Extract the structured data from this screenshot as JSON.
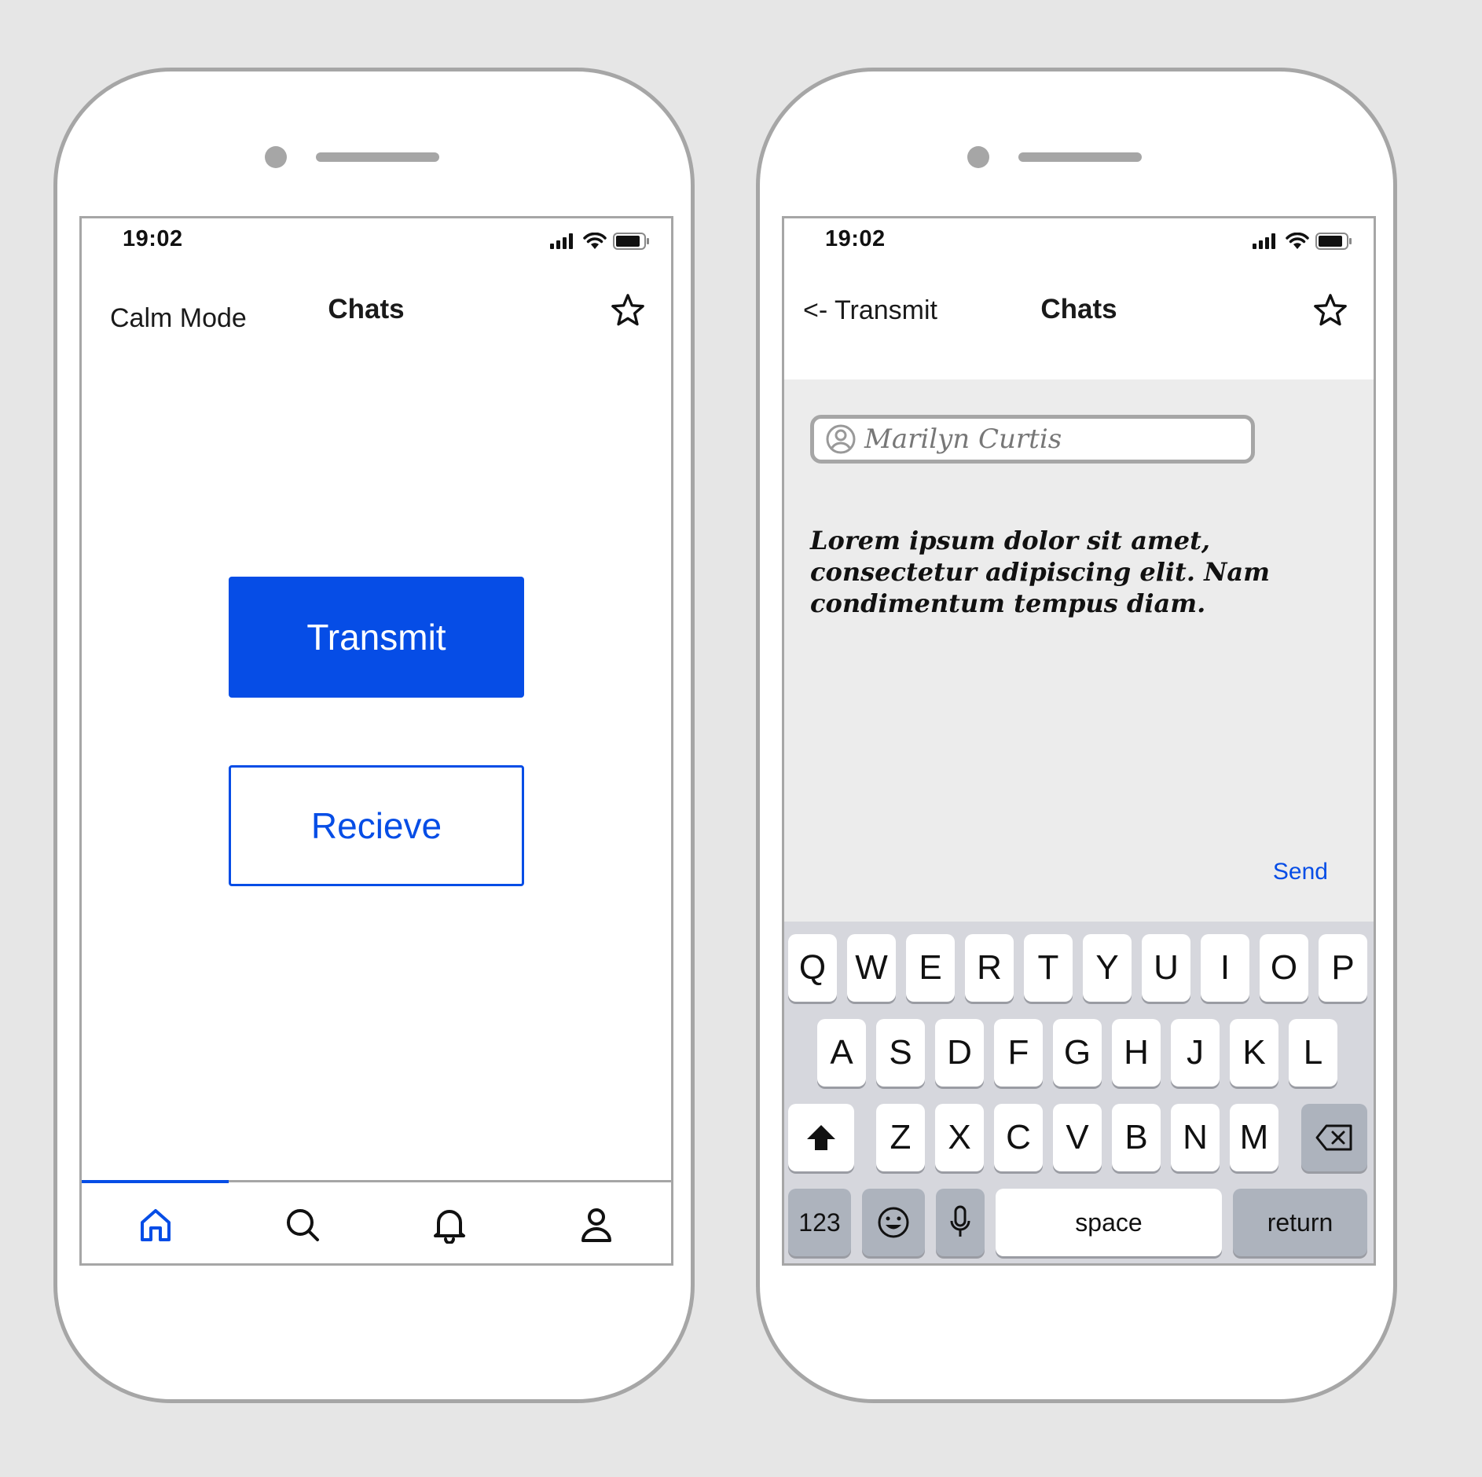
{
  "colors": {
    "accent": "#064de6",
    "background": "#e6e6e6",
    "frame": "#a6a6a6",
    "compose_bg": "#ececec",
    "keyboard_bg": "#d6d7dd",
    "key_dark": "#adb3bd"
  },
  "left_phone": {
    "status": {
      "time": "19:02",
      "icons": [
        "signal-icon",
        "wifi-icon",
        "battery-icon"
      ]
    },
    "nav": {
      "left_label": "Calm Mode",
      "title": "Chats",
      "right_icon": "star-icon"
    },
    "buttons": {
      "transmit_label": "Transmit",
      "receive_label": "Recieve"
    },
    "tab_bar": {
      "active_tab": "home",
      "tabs": [
        "home-icon",
        "search-icon",
        "bell-icon",
        "user-icon"
      ]
    }
  },
  "right_phone": {
    "status": {
      "time": "19:02",
      "icons": [
        "signal-icon",
        "wifi-icon",
        "battery-icon"
      ]
    },
    "nav": {
      "back_label": "<- Transmit",
      "title": "Chats",
      "right_icon": "star-icon"
    },
    "compose": {
      "recipient": "Marilyn Curtis",
      "message": "Lorem ipsum dolor sit amet, consectetur adipiscing elit. Nam condimentum tempus diam.",
      "send_label": "Send"
    },
    "keyboard": {
      "row1": [
        "Q",
        "W",
        "E",
        "R",
        "T",
        "Y",
        "U",
        "I",
        "O",
        "P"
      ],
      "row2": [
        "A",
        "S",
        "D",
        "F",
        "G",
        "H",
        "J",
        "K",
        "L"
      ],
      "row3": [
        "Z",
        "X",
        "C",
        "V",
        "B",
        "N",
        "M"
      ],
      "numbers_label": "123",
      "space_label": "space",
      "return_label": "return"
    }
  }
}
